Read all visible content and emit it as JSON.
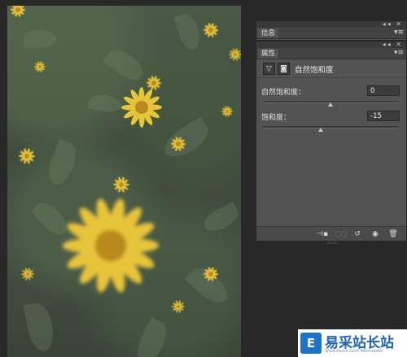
{
  "info_panel": {
    "title": "信息",
    "collapse": "◂◂",
    "close": "✕",
    "menu": "▾≡"
  },
  "properties_panel": {
    "title": "属性",
    "collapse": "◂◂",
    "close": "✕",
    "menu": "▾≡",
    "header": {
      "label": "自然饱和度",
      "adjustment_icon": "triangle-adjustment-icon",
      "mask_icon": "mask-icon"
    },
    "fields": [
      {
        "label": "自然饱和度：",
        "value": "0",
        "slider_fraction": 0.5
      },
      {
        "label": "饱和度：",
        "value": "-15",
        "slider_fraction": 0.425
      }
    ],
    "footer_icons": [
      "clip-to-layer-icon",
      "view-previous-icon",
      "reset-icon",
      "visibility-icon",
      "delete-icon"
    ]
  },
  "watermark": {
    "logo_glyph": "E",
    "text": "易采站长站",
    "sub": "Www.Easck.Com  Webmaster"
  },
  "colors": {
    "panel_bg": "#535353",
    "panel_dark": "#424242",
    "canvas": "#282828",
    "flower": "#e8c43a"
  }
}
